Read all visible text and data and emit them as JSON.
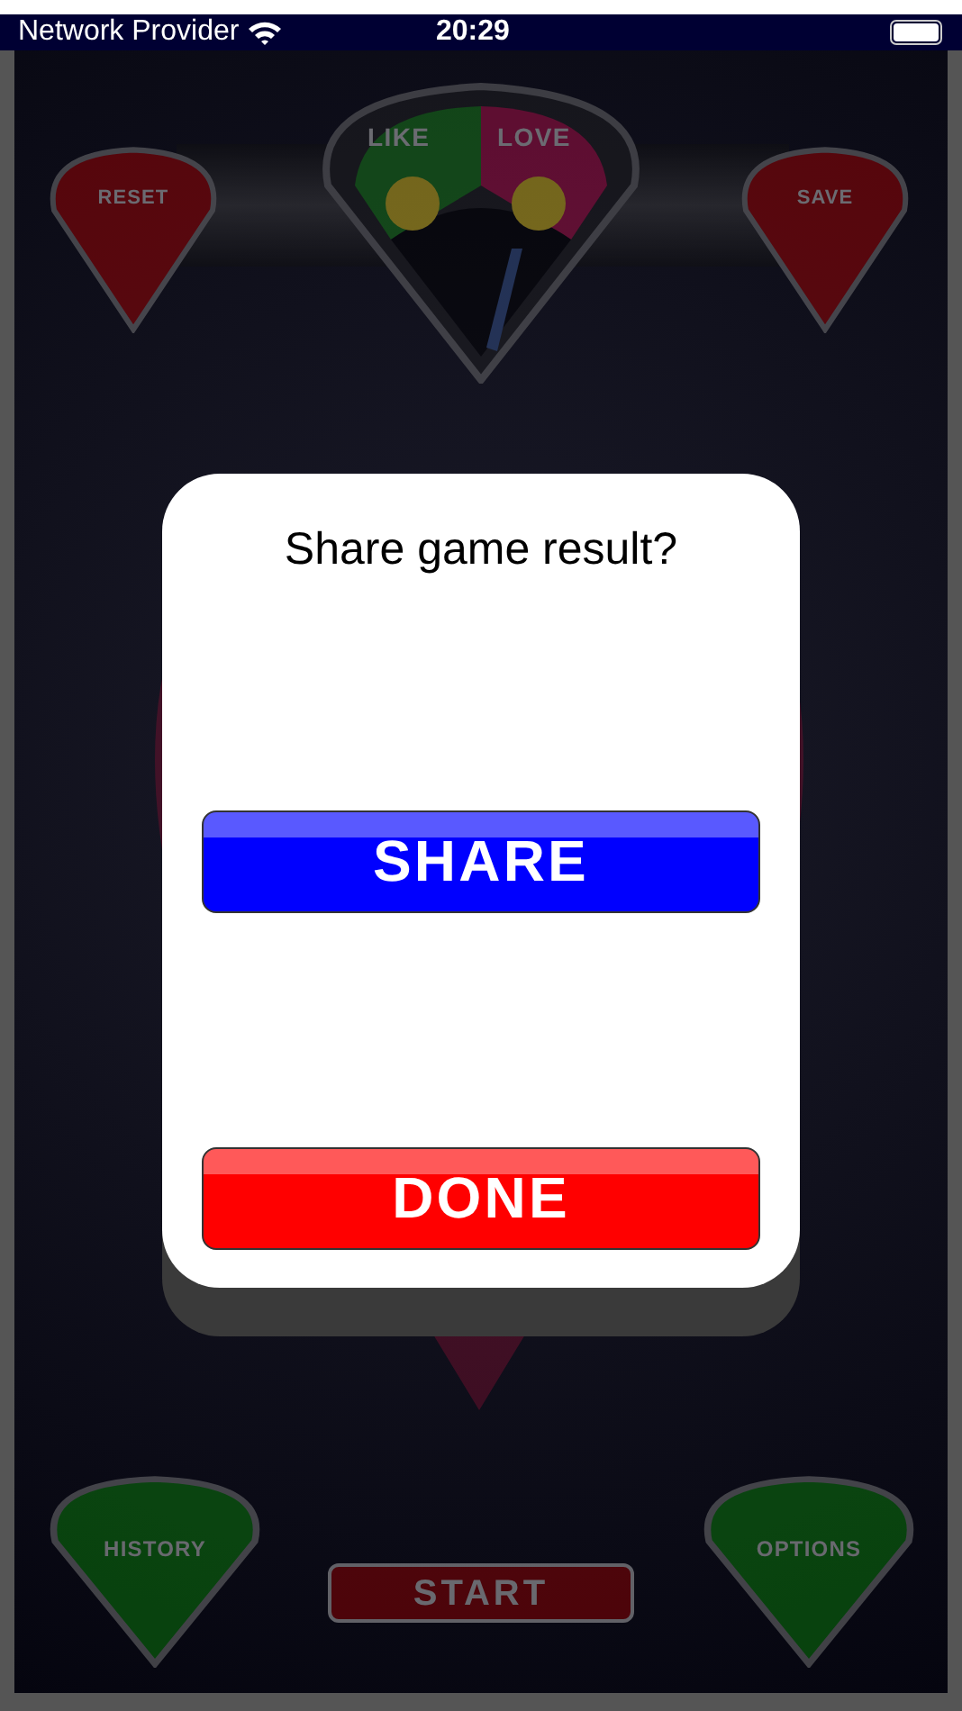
{
  "status_bar": {
    "carrier": "Network Provider",
    "time": "20:29"
  },
  "game": {
    "meter": {
      "labels": [
        "LIKE",
        "LOVE"
      ]
    },
    "top_buttons": [
      {
        "label": "RESET"
      },
      {
        "label": "SAVE"
      }
    ],
    "bottom_buttons": [
      {
        "label": "HISTORY"
      },
      {
        "label": "OPTIONS"
      }
    ],
    "start_button": {
      "label": "START"
    }
  },
  "dialog": {
    "title": "Share game result?",
    "buttons": [
      {
        "label": "SHARE",
        "kind": "share"
      },
      {
        "label": "DONE",
        "kind": "done"
      }
    ]
  }
}
